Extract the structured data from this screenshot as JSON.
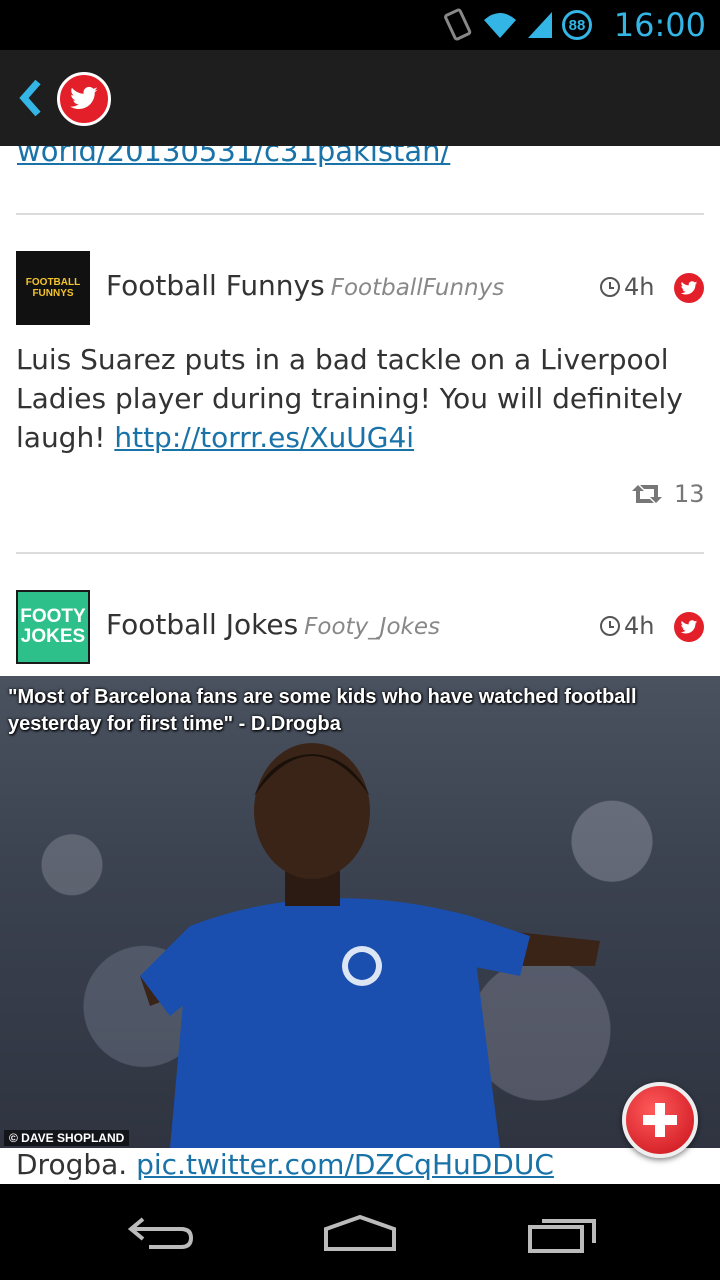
{
  "status_bar": {
    "time": "16:00",
    "battery": "88",
    "icons": [
      "screen-rotation-icon",
      "wifi-icon",
      "signal-icon",
      "battery-icon"
    ]
  },
  "action_bar": {
    "back_icon": "chevron-left-icon",
    "logo_icon": "twitter-icon"
  },
  "feed": {
    "previous_link": "world/20130531/c31pakistan/",
    "tweets": [
      {
        "avatar_text": "FOOTBALL FUNNYS",
        "author": "Football Funnys",
        "handle": "FootballFunnys",
        "time_ago": "4h",
        "text": "Luis Suarez puts in a bad tackle on a Liverpool Ladies player during training! You will definitely laugh!",
        "link": "http://torrr.es/XuUG4i",
        "retweets": "13"
      },
      {
        "avatar_text": "FOOTY JOKES",
        "author": "Football Jokes",
        "handle": "Footy_Jokes",
        "time_ago": "4h",
        "image_caption": "\"Most of Barcelona fans are some kids who have watched football yesterday for first time\" - D.Drogba",
        "image_credit": "© DAVE SHOPLAND",
        "text": "Drogba.",
        "link": "pic.twitter.com/DZCqHuDDUC"
      }
    ]
  },
  "fab": {
    "icon": "plus-icon"
  },
  "nav_bar": {
    "icons": [
      "back-icon",
      "home-icon",
      "recent-apps-icon"
    ]
  },
  "colors": {
    "accent": "#33b5e5",
    "twitter_red": "#e3202a",
    "link": "#1a73a8"
  }
}
